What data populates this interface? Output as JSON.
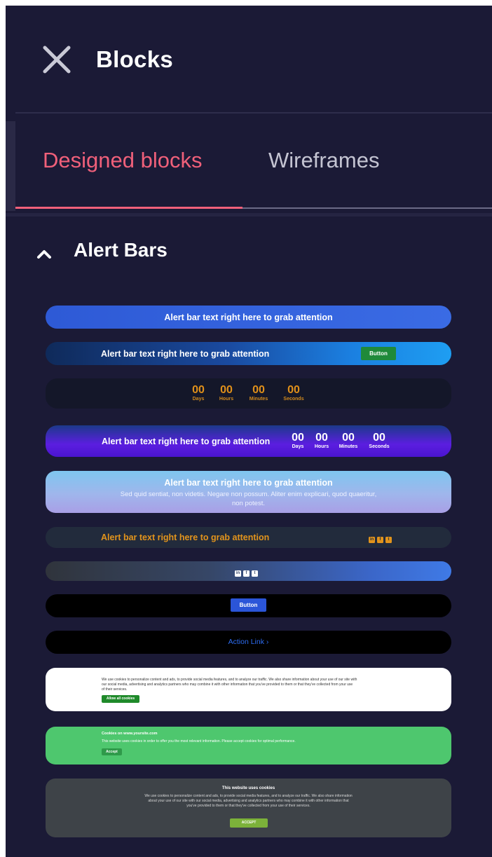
{
  "header": {
    "title": "Blocks",
    "close_icon": "close-icon"
  },
  "tabs": [
    {
      "label": "Designed blocks",
      "active": true
    },
    {
      "label": "Wireframes",
      "active": false
    }
  ],
  "section": {
    "title": "Alert Bars",
    "icon": "chevron-up-icon",
    "expanded": true
  },
  "colors": {
    "panel": "#1b1a36",
    "accent": "#f0607a",
    "tab_inactive": "#c4c4d2"
  },
  "blocks": {
    "b1": {
      "text": "Alert bar text right here to grab attention"
    },
    "b2": {
      "text": "Alert bar text right here to grab attention",
      "button": "Button"
    },
    "b3": {
      "units": [
        {
          "num": "00",
          "label": "Days"
        },
        {
          "num": "00",
          "label": "Hours"
        },
        {
          "num": "00",
          "label": "Minutes"
        },
        {
          "num": "00",
          "label": "Seconds"
        }
      ]
    },
    "b4": {
      "text": "Alert bar text right here to grab attention",
      "units": [
        {
          "num": "00",
          "label": "Days"
        },
        {
          "num": "00",
          "label": "Hours"
        },
        {
          "num": "00",
          "label": "Minutes"
        },
        {
          "num": "00",
          "label": "Seconds"
        }
      ]
    },
    "b5": {
      "text": "Alert bar text right here to grab attention",
      "sub1": "Sed quid sentiat, non videtis. Negare non possum. Aliter enim explicari, quod quaeritur,",
      "sub2": "non potest."
    },
    "b6": {
      "text": "Alert bar text right here to grab attention",
      "icons": [
        "in",
        "f",
        "t"
      ]
    },
    "b7": {
      "icons": [
        "in",
        "f",
        "t"
      ]
    },
    "b8": {
      "button": "Button"
    },
    "b9": {
      "link": "Action Link ›"
    },
    "b10": {
      "line1": "We use cookies to personalize content and ads, to provide social media features, and to analyze our traffic. We also share information about your use of our site with",
      "line2": "our social media, advertising and analytics partners who may combine it with other information that you've provided to them or that they've collected from your use",
      "line3": "of their services.",
      "button": "Allow all cookies"
    },
    "b11": {
      "title": "Cookies on www.yoursite.com",
      "text": "This website uses cookies in order to offer you the most relevant information. Please accept cookies for optimal performance.",
      "button": "Accept"
    },
    "b12": {
      "title": "This website uses cookies",
      "line1": "We use cookies to personalize content and ads, to provide social media features, and to analyze our traffic. We also share information",
      "line2": "about your use of our site with our social media, advertising and analytics partners who may combine it with other information that",
      "line3": "you've provided to them or that they've collected from your use of their services.",
      "button": "ACCEPT"
    }
  }
}
